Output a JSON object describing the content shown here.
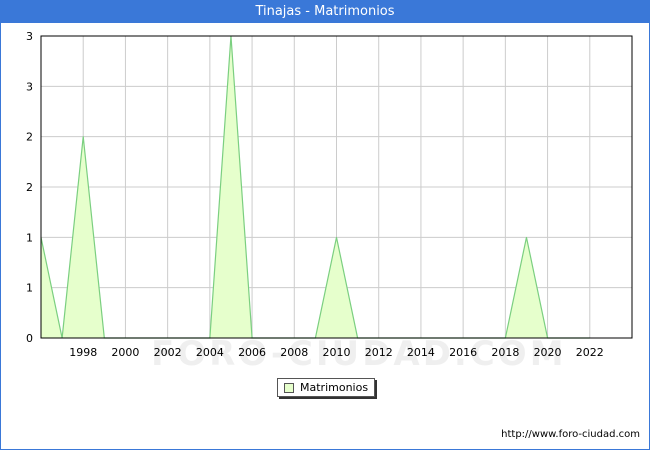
{
  "title": "Tinajas - Matrimonios",
  "source": "http://www.foro-ciudad.com",
  "watermark": "FORO-CIUDAD.COM",
  "colors": {
    "accent": "#3a78d8",
    "line": "#7bcf80",
    "fill": "#e6ffcc",
    "grid": "#cccccc"
  },
  "legend": {
    "label": "Matrimonios"
  },
  "chart_data": {
    "type": "area",
    "title": "Tinajas - Matrimonios",
    "xlabel": "",
    "ylabel": "",
    "xlim": [
      1996,
      2024
    ],
    "ylim": [
      0,
      3
    ],
    "x_ticks": [
      1998,
      2000,
      2002,
      2004,
      2006,
      2008,
      2010,
      2012,
      2014,
      2016,
      2018,
      2020,
      2022
    ],
    "y_tick_values": [
      0,
      0.5,
      1,
      1.5,
      2,
      2.5,
      3
    ],
    "y_tick_labels": [
      "0",
      "1",
      "1",
      "2",
      "2",
      "3",
      "3"
    ],
    "grid": true,
    "legend_position": "bottom-center",
    "series": [
      {
        "name": "Matrimonios",
        "x": [
          1996,
          1997,
          1998,
          1999,
          2000,
          2001,
          2002,
          2003,
          2004,
          2005,
          2006,
          2007,
          2008,
          2009,
          2010,
          2011,
          2012,
          2013,
          2014,
          2015,
          2016,
          2017,
          2018,
          2019,
          2020,
          2021,
          2022
        ],
        "values": [
          1,
          0,
          2,
          0,
          0,
          0,
          0,
          0,
          0,
          3,
          0,
          0,
          0,
          0,
          1,
          0,
          0,
          0,
          0,
          0,
          0,
          0,
          0,
          1,
          0,
          0,
          0
        ]
      }
    ]
  }
}
